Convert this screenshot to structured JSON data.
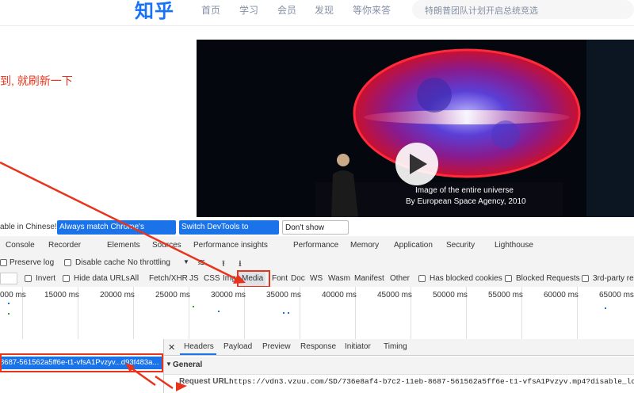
{
  "header": {
    "logo": "知乎",
    "nav": [
      "首页",
      "学习",
      "会员",
      "发现",
      "等你来答"
    ],
    "search_placeholder": "特朗普团队计划开启总统竞选"
  },
  "note": "到, 就刷新一下",
  "video": {
    "caption_line1": "Image of the entire universe",
    "caption_line2": "By European Space Agency, 2010"
  },
  "devtools": {
    "notice": {
      "text": "able in Chinese!",
      "match_btn": "Always match Chrome's language",
      "switch_btn": "Switch DevTools to Chinese",
      "dismiss_btn": "Don't show again"
    },
    "tabs": [
      "Console",
      "Recorder",
      "Elements",
      "Sources",
      "Performance insights",
      "Performance",
      "Memory",
      "Application",
      "Security",
      "Lighthouse"
    ],
    "toolbar1": {
      "preserve_log": "Preserve log",
      "disable_cache": "Disable cache",
      "throttling": "No throttling"
    },
    "filters": {
      "invert": "Invert",
      "hide_data_urls": "Hide data URLs",
      "types": [
        "All",
        "Fetch/XHR",
        "JS",
        "CSS",
        "Img",
        "Media",
        "Font",
        "Doc",
        "WS",
        "Wasm",
        "Manifest",
        "Other"
      ],
      "has_blocked_cookies": "Has blocked cookies",
      "blocked_requests": "Blocked Requests",
      "third_party": "3rd-party re"
    },
    "timeline_ticks": [
      "000 ms",
      "15000 ms",
      "20000 ms",
      "25000 ms",
      "30000 ms",
      "35000 ms",
      "40000 ms",
      "45000 ms",
      "50000 ms",
      "55000 ms",
      "60000 ms",
      "65000 ms"
    ],
    "request_name": "8687-561562a5ff6e-t1-vfsA1Pvzyv...d93f483a...",
    "detail_tabs": [
      "Headers",
      "Payload",
      "Preview",
      "Response",
      "Initiator",
      "Timing"
    ],
    "general_label": "General",
    "request_url_label": "Request URL:",
    "request_url": "https://vdn3.vzuu.com/SD/736e8af4-b7c2-11eb-8687-561562a5ff6e-t1-vfsA1Pvzyv.mp4?disable_local_cac"
  }
}
